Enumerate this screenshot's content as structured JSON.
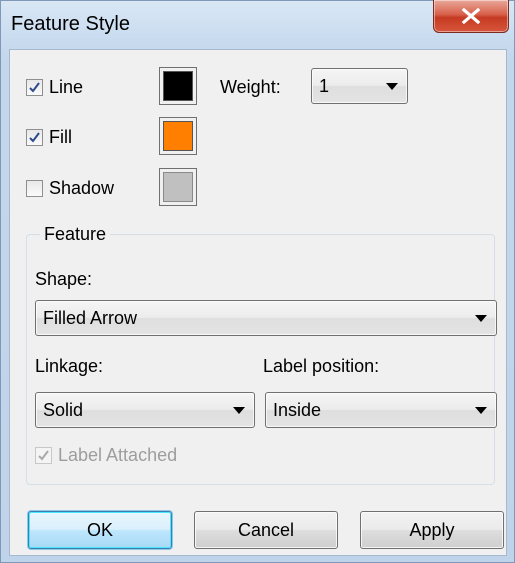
{
  "window": {
    "title": "Feature Style"
  },
  "style": {
    "line": {
      "label": "Line",
      "checked": true,
      "color": "#000000"
    },
    "fill": {
      "label": "Fill",
      "checked": true,
      "color": "#ff8000"
    },
    "shadow": {
      "label": "Shadow",
      "checked": false,
      "color": "#c0c0c0"
    },
    "weight": {
      "label": "Weight:",
      "value": "1"
    }
  },
  "feature": {
    "legend": "Feature",
    "shape": {
      "label": "Shape:",
      "value": "Filled Arrow"
    },
    "linkage": {
      "label": "Linkage:",
      "value": "Solid"
    },
    "label_position": {
      "label": "Label position:",
      "value": "Inside"
    },
    "label_attached": {
      "label": "Label Attached",
      "checked": true,
      "enabled": false
    }
  },
  "buttons": {
    "ok": "OK",
    "cancel": "Cancel",
    "apply": "Apply"
  },
  "icons": {
    "close": "close-icon",
    "check": "checkmark-icon",
    "dropdown": "chevron-down-icon"
  }
}
